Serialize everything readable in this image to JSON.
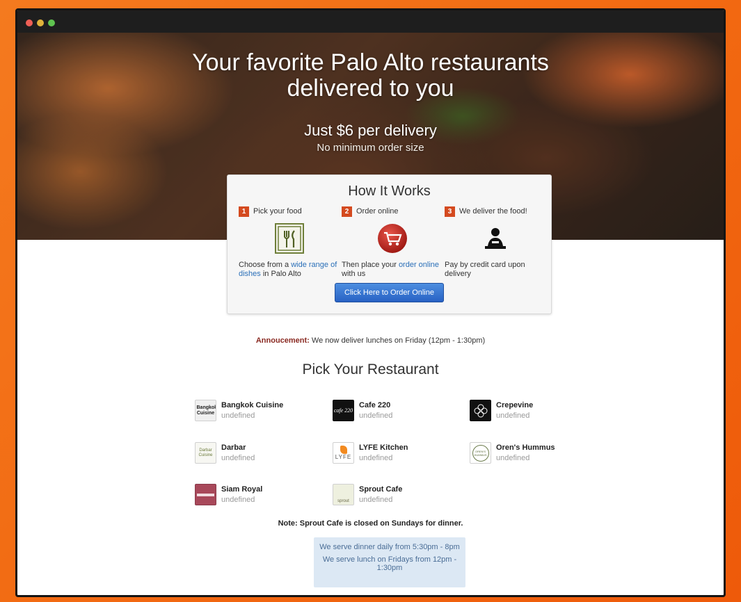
{
  "window": {
    "controls": [
      "close",
      "minimize",
      "zoom"
    ]
  },
  "hero": {
    "title_line1": "Your favorite Palo Alto restaurants",
    "title_line2": "delivered to you",
    "price": "Just $6 per delivery",
    "minimum": "No minimum order size"
  },
  "how_it_works": {
    "title": "How It Works",
    "steps": [
      {
        "num": "1",
        "title": "Pick your food",
        "icon": "fork-knife-icon",
        "desc_pre": "Choose from a ",
        "desc_link": "wide range of dishes",
        "desc_post": " in Palo Alto"
      },
      {
        "num": "2",
        "title": "Order online",
        "icon": "shopping-cart-icon",
        "desc_pre": "Then place your ",
        "desc_link": "order online",
        "desc_post": " with us"
      },
      {
        "num": "3",
        "title": "We deliver the food!",
        "icon": "delivery-person-icon",
        "desc_pre": "Pay by credit card upon delivery",
        "desc_link": "",
        "desc_post": ""
      }
    ],
    "button": "Click Here to Order Online"
  },
  "announcement": {
    "label": "Annoucement:",
    "text": " We now deliver lunches on Friday (12pm - 1:30pm)"
  },
  "restaurants_title": "Pick Your Restaurant",
  "restaurants": [
    {
      "name": "Bangkok Cuisine",
      "sub": "undefined",
      "logo_text": "Bangkok Cuisine"
    },
    {
      "name": "Cafe 220",
      "sub": "undefined",
      "logo_text": "cafe 220"
    },
    {
      "name": "Crepevine",
      "sub": "undefined",
      "logo_text": ""
    },
    {
      "name": "Darbar",
      "sub": "undefined",
      "logo_text": "Darbar Cuisine"
    },
    {
      "name": "LYFE Kitchen",
      "sub": "undefined",
      "logo_text": "LYFE"
    },
    {
      "name": "Oren's Hummus",
      "sub": "undefined",
      "logo_text": "OREN'S HUMMUS"
    },
    {
      "name": "Siam Royal",
      "sub": "undefined",
      "logo_text": ""
    },
    {
      "name": "Sprout Cafe",
      "sub": "undefined",
      "logo_text": "sprout"
    }
  ],
  "note": "Note: Sprout Cafe is closed on Sundays for dinner.",
  "hours": {
    "dinner": "We serve dinner daily from 5:30pm - 8pm",
    "lunch": "We serve lunch on Fridays from 12pm - 1:30pm"
  },
  "colors": {
    "accent_orange": "#f26a12",
    "step_badge": "#d44a1f",
    "link_blue": "#2a6fb8",
    "button_blue": "#2862c4",
    "announcement_red": "#8a2a22",
    "hours_bg": "#dce8f4"
  }
}
